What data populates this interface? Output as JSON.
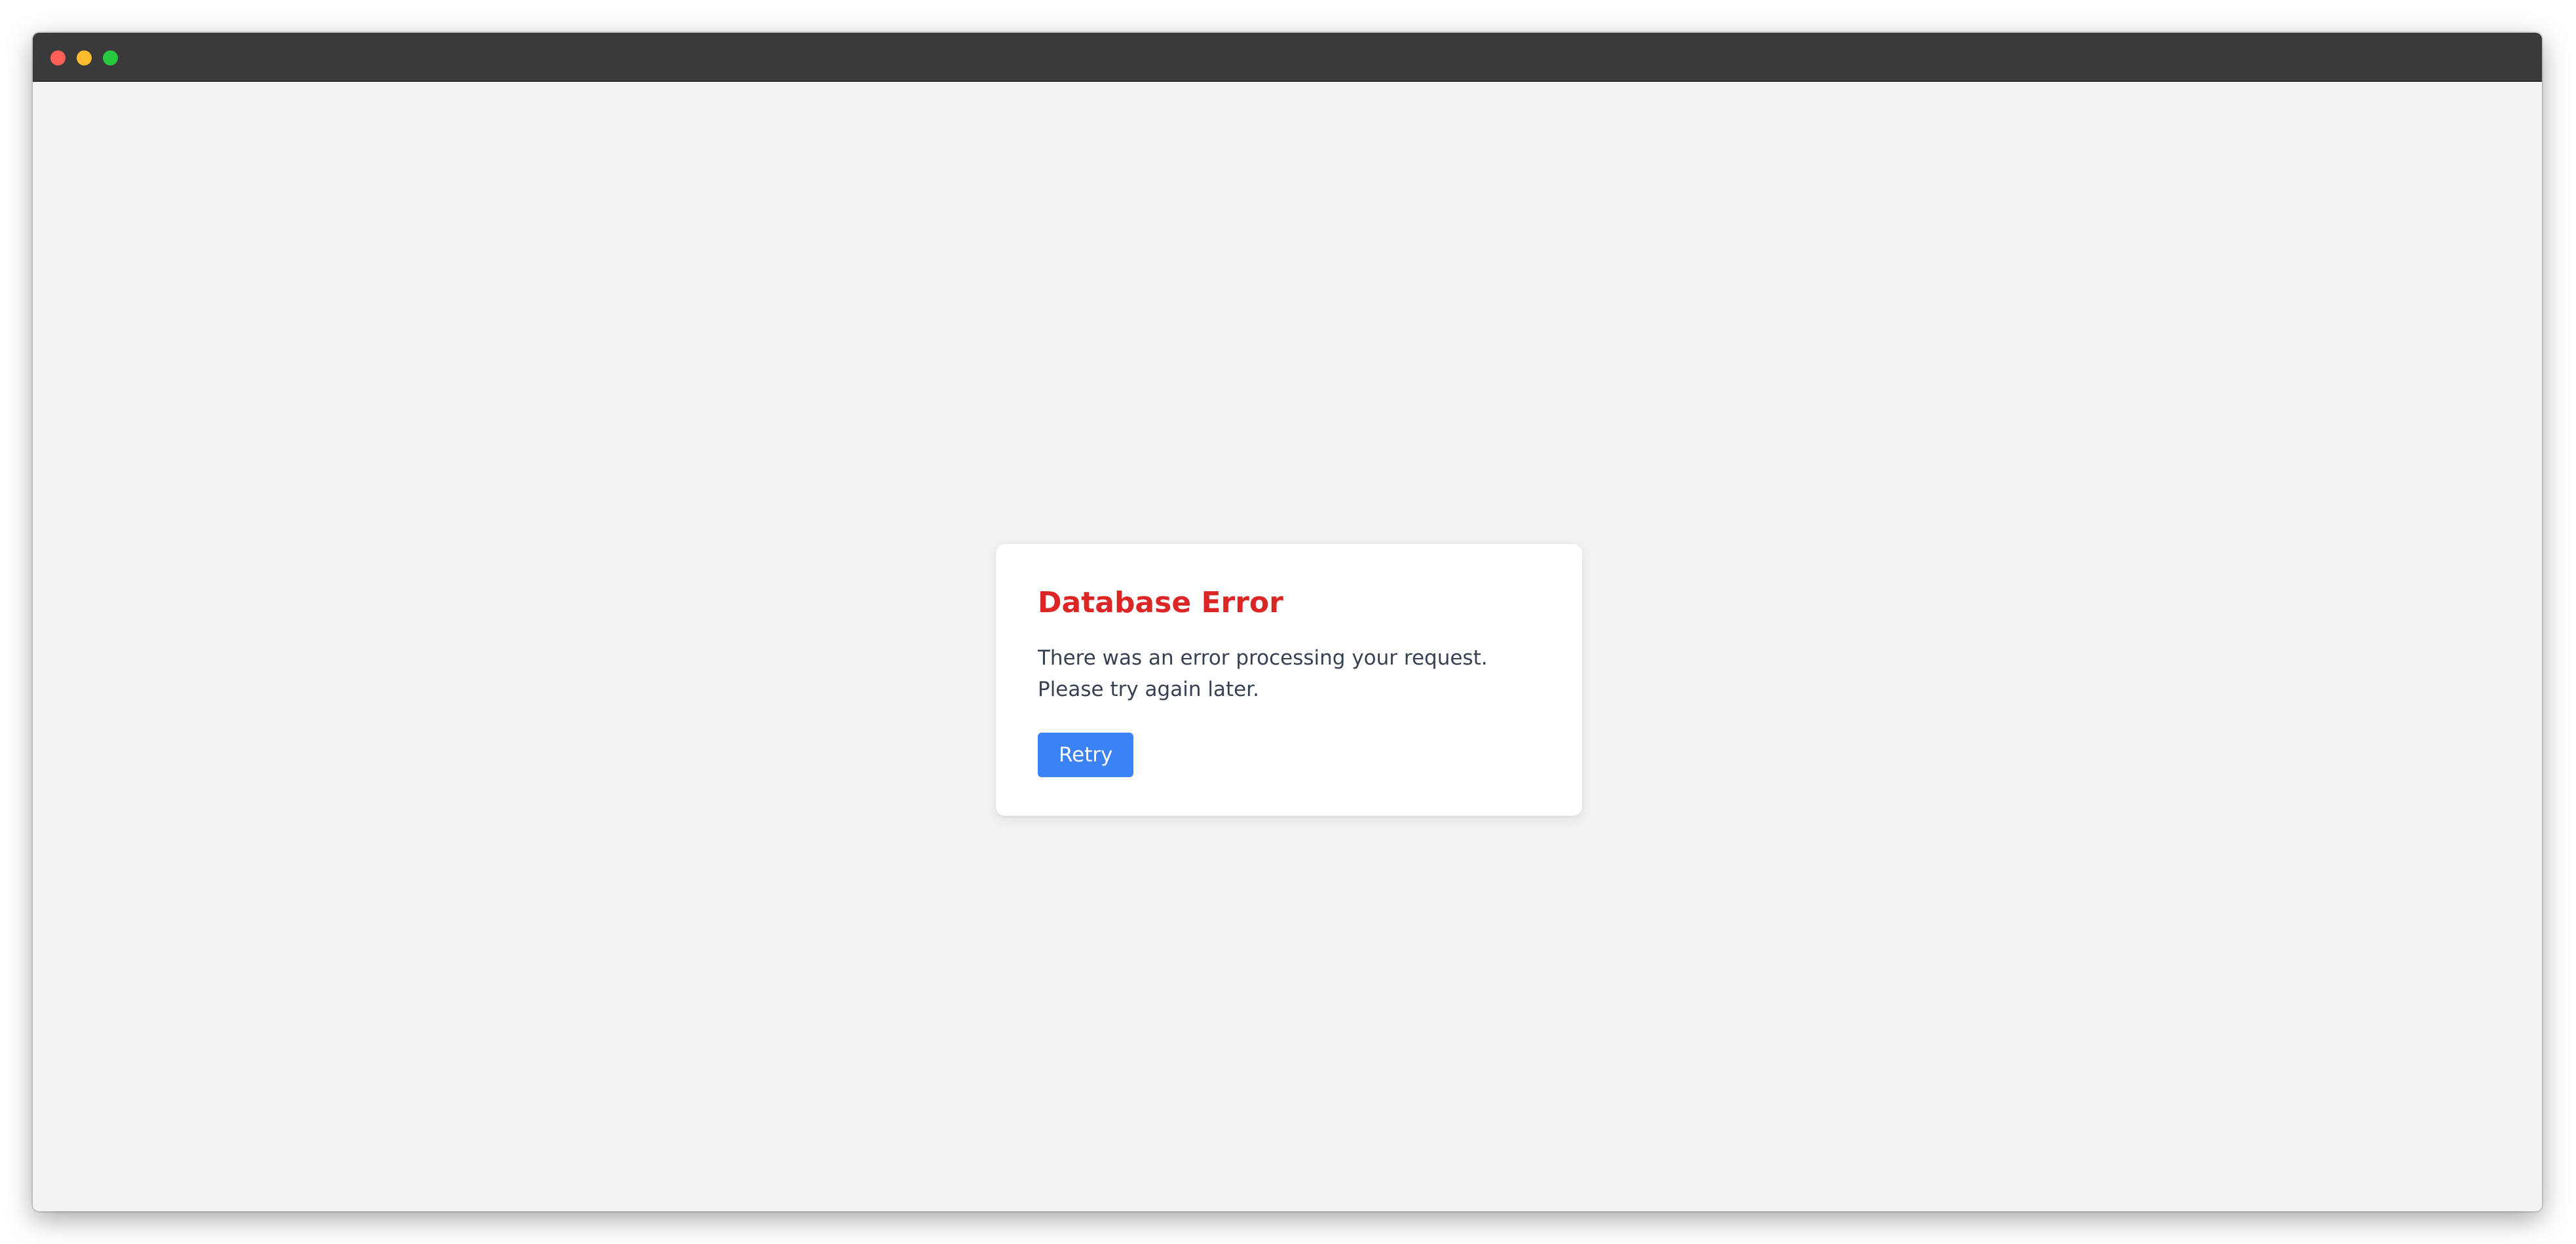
{
  "window": {
    "controls": [
      "close",
      "minimize",
      "maximize"
    ]
  },
  "dialog": {
    "title": "Database Error",
    "message": "There was an error processing your request. Please try again later.",
    "retry_label": "Retry"
  },
  "colors": {
    "titlebar": "#3a3a3a",
    "background": "#f2f3f5",
    "error_title": "#dc2626",
    "button": "#3b82f6",
    "close": "#ff5f56",
    "minimize": "#ffbd2e",
    "maximize": "#27c93f"
  }
}
